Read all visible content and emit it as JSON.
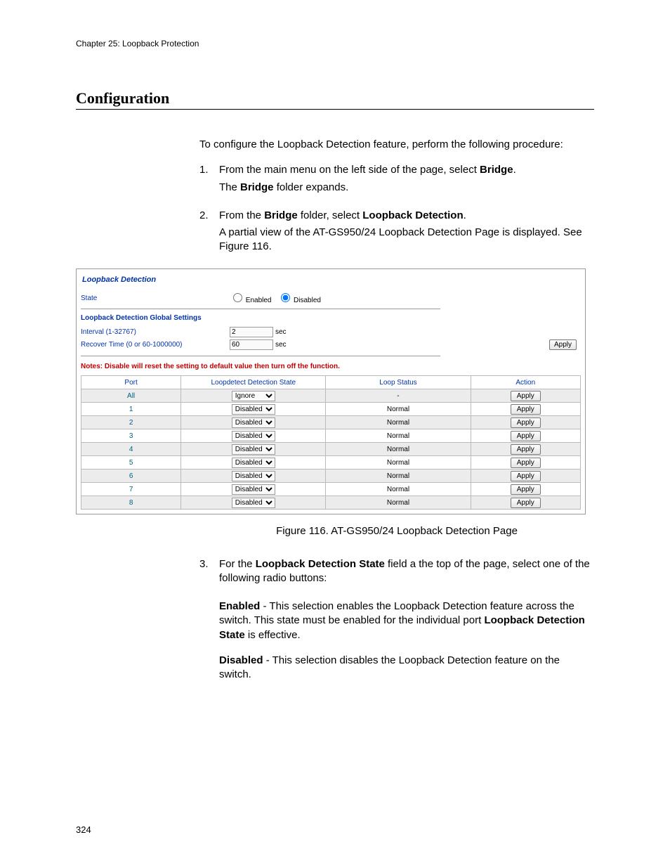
{
  "chapter_header": "Chapter 25: Loopback Protection",
  "section_title": "Configuration",
  "intro": "To configure the Loopback Detection feature, perform the following procedure:",
  "steps": {
    "s1": {
      "num": "1.",
      "line1a": "From the main menu on the left side of the page, select ",
      "line1b_bold": "Bridge",
      "line1c": ".",
      "line2a": "The ",
      "line2b_bold": "Bridge",
      "line2c": " folder expands."
    },
    "s2": {
      "num": "2.",
      "line1a": "From the ",
      "line1b_bold": "Bridge",
      "line1c": " folder, select ",
      "line1d_bold": "Loopback Detection",
      "line1e": ".",
      "line2": "A partial view of the AT-GS950/24 Loopback Detection Page is displayed. See Figure 116."
    },
    "s3": {
      "num": "3.",
      "line1a": "For the ",
      "line1b_bold": "Loopback Detection State",
      "line1c": " field a the top of the page, select one of the following radio buttons:"
    }
  },
  "figure_caption": "Figure 116. AT-GS950/24 Loopback Detection Page",
  "enabled_para": {
    "bold": "Enabled",
    "text_a": " - This selection enables the Loopback Detection feature across the switch. This state must be enabled for the individual port ",
    "bold2": "Loopback Detection State",
    "text_b": " is effective."
  },
  "disabled_para": {
    "bold": "Disabled",
    "text": " - This selection disables the Loopback Detection feature on the switch."
  },
  "page_number": "324",
  "shot": {
    "title": "Loopback Detection",
    "state_label": "State",
    "radio_enabled": "Enabled",
    "radio_disabled": "Disabled",
    "global_settings_hdr": "Loopback Detection Global Settings",
    "interval_label": "Interval (1-32767)",
    "interval_value": "2",
    "recover_label": "Recover Time (0 or 60-1000000)",
    "recover_value": "60",
    "unit_sec": "sec",
    "apply_label": "Apply",
    "note": "Notes: Disable will reset the setting to default value then turn off the function.",
    "thead": {
      "port": "Port",
      "state": "Loopdetect Detection State",
      "loop": "Loop Status",
      "action": "Action"
    },
    "state_opts": {
      "ignore": "Ignore",
      "disabled": "Disabled"
    },
    "loop_normal": "Normal",
    "loop_dash": "-",
    "rows": [
      {
        "port": "All",
        "state": "Ignore",
        "loop": "-",
        "alt": true
      },
      {
        "port": "1",
        "state": "Disabled",
        "loop": "Normal",
        "alt": false
      },
      {
        "port": "2",
        "state": "Disabled",
        "loop": "Normal",
        "alt": true
      },
      {
        "port": "3",
        "state": "Disabled",
        "loop": "Normal",
        "alt": false
      },
      {
        "port": "4",
        "state": "Disabled",
        "loop": "Normal",
        "alt": true
      },
      {
        "port": "5",
        "state": "Disabled",
        "loop": "Normal",
        "alt": false
      },
      {
        "port": "6",
        "state": "Disabled",
        "loop": "Normal",
        "alt": true
      },
      {
        "port": "7",
        "state": "Disabled",
        "loop": "Normal",
        "alt": false
      },
      {
        "port": "8",
        "state": "Disabled",
        "loop": "Normal",
        "alt": true
      }
    ]
  }
}
